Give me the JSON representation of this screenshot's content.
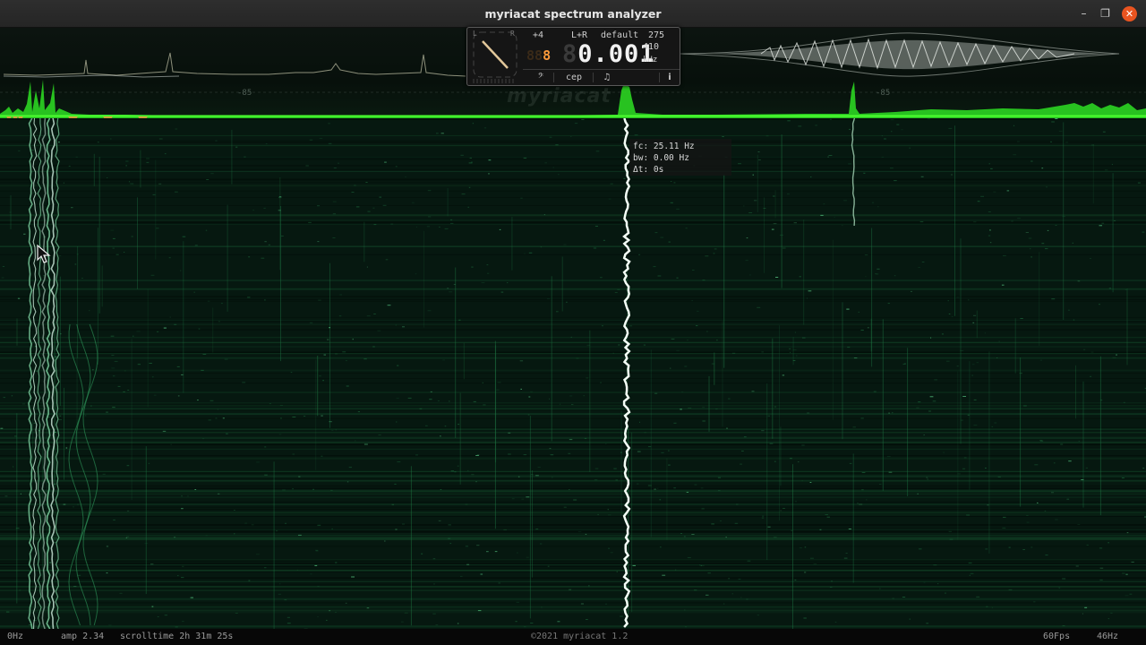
{
  "window": {
    "title": "myriacat spectrum analyzer",
    "minimize_label": "–",
    "maximize_label": "❐",
    "close_label": "✕"
  },
  "header": {
    "db_labels": [
      "-85",
      "-85"
    ],
    "watermark": "myriacat"
  },
  "panel": {
    "channel_left": "L",
    "channel_right": "R",
    "transpose": "+4",
    "channel_mode": "L+R",
    "preset": "default",
    "preset_value": "275",
    "small_digits_ghost": "88",
    "small_digits_on": "8",
    "freq_ghost": "8",
    "freq_value": "0.001",
    "reference": "410",
    "unit": "kHz",
    "clef_button": "𝄢",
    "cep_button": "cep",
    "note_button": "♫",
    "info_button": "i"
  },
  "readout": {
    "fc": "fc: 25.11 Hz",
    "bw": "bw: 0.00 Hz",
    "dt": "Δt: 0s"
  },
  "status": {
    "min_freq": "0Hz",
    "amp": "amp 2.34",
    "scrolltime": "scrolltime 2h 31m 25s",
    "copyright": "©2021 myriacat 1.2",
    "fps": "60Fps",
    "max_freq": "46Hz"
  },
  "colors": {
    "spectrum_green": "#3dff2a",
    "waterfall_bg": "#071a10",
    "trace_white": "#f4fff6",
    "marker_gold": "#c9a23a",
    "close_orange": "#e95420"
  }
}
